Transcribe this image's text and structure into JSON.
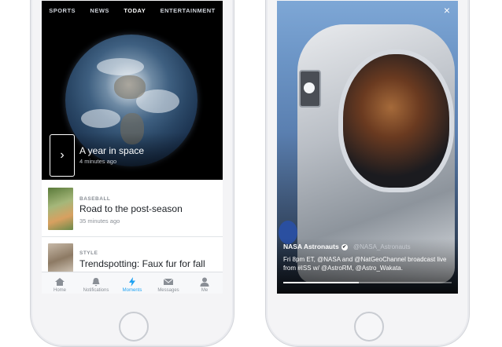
{
  "left_screen": {
    "tabs": [
      {
        "label": "SPORTS",
        "active": false
      },
      {
        "label": "NEWS",
        "active": false
      },
      {
        "label": "TODAY",
        "active": true
      },
      {
        "label": "ENTERTAINMENT",
        "active": false
      }
    ],
    "hero": {
      "title": "A year in space",
      "time": "4 minutes ago",
      "arrow_glyph": "›"
    },
    "list": [
      {
        "kicker": "BASEBALL",
        "title": "Road to the post-season",
        "time": "35 minutes ago"
      },
      {
        "kicker": "STYLE",
        "title": "Trendspotting: Faux fur for fall"
      }
    ],
    "tabbar": [
      {
        "label": "Home",
        "icon": "home-icon",
        "active": false
      },
      {
        "label": "Notifications",
        "icon": "bell-icon",
        "active": false
      },
      {
        "label": "Moments",
        "icon": "lightning-icon",
        "active": true
      },
      {
        "label": "Messages",
        "icon": "envelope-icon",
        "active": false
      },
      {
        "label": "Me",
        "icon": "person-icon",
        "active": false
      }
    ],
    "accent": "#1da1f2"
  },
  "right_screen": {
    "close_glyph": "×",
    "author": "NASA Astronauts",
    "verified_glyph": "✔",
    "handle": "@NASA_Astronauts",
    "text": "Fri 8pm ET, @NASA and @NatGeoChannel broadcast live from #ISS w/ @AstroRM, @Astro_Wakata.",
    "progress": 0.45
  }
}
